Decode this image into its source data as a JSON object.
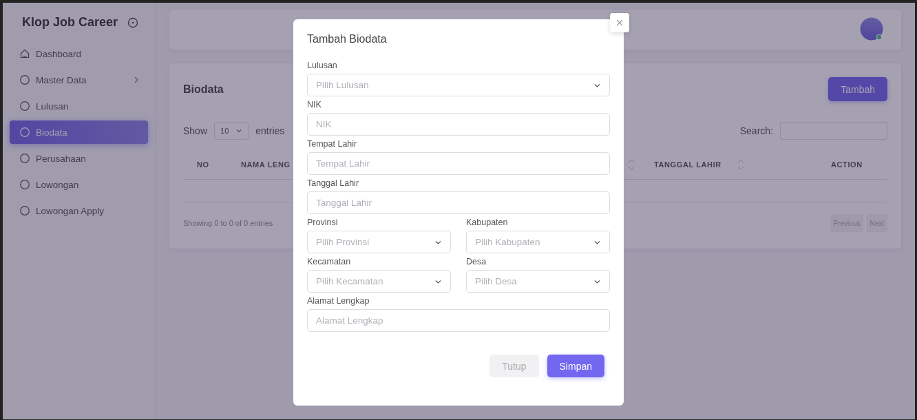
{
  "sidebar": {
    "brand": "Klop Job Career",
    "items": [
      {
        "label": "Dashboard",
        "has_submenu": false,
        "selected": false
      },
      {
        "label": "Master Data",
        "has_submenu": true,
        "selected": false
      },
      {
        "label": "Lulusan",
        "has_submenu": false,
        "selected": false
      },
      {
        "label": "Biodata",
        "has_submenu": false,
        "selected": true
      },
      {
        "label": "Perusahaan",
        "has_submenu": false,
        "selected": false
      },
      {
        "label": "Lowongan",
        "has_submenu": false,
        "selected": false
      },
      {
        "label": "Lowongan Apply",
        "has_submenu": false,
        "selected": false
      }
    ]
  },
  "card": {
    "title": "Biodata",
    "add_button": "Tambah",
    "show_label": "Show",
    "page_size": "10",
    "entries_label": "entries",
    "search_label": "Search:",
    "columns": [
      {
        "label": "NO",
        "sortable": false
      },
      {
        "label": "NAMA LENG",
        "sortable": true
      },
      {
        "label": "TANGGAL LAHIR",
        "sortable": true
      },
      {
        "label": "ACTION",
        "sortable": false
      }
    ],
    "info": "Showing 0 to 0 of 0 entries",
    "pager": [
      "Previous",
      "Next"
    ]
  },
  "modal": {
    "title": "Tambah Biodata",
    "rows": [
      [
        {
          "label": "Lulusan",
          "kind": "select",
          "placeholder": "Pilih Lulusan"
        }
      ],
      [
        {
          "label": "NIK",
          "kind": "input",
          "placeholder": "NIK"
        }
      ],
      [
        {
          "label": "Tempat Lahir",
          "kind": "input",
          "placeholder": "Tempat Lahir"
        }
      ],
      [
        {
          "label": "Tanggal Lahir",
          "kind": "input",
          "placeholder": "Tanggal Lahir"
        }
      ],
      [
        {
          "label": "Provinsi",
          "kind": "select",
          "placeholder": "Pilih Provinsi"
        },
        {
          "label": "Kabupaten",
          "kind": "select",
          "placeholder": "Pilih Kabupaten"
        }
      ],
      [
        {
          "label": "Kecamatan",
          "kind": "select",
          "placeholder": "Pilih Kecamatan"
        },
        {
          "label": "Desa",
          "kind": "select",
          "placeholder": "Pilih Desa"
        }
      ],
      [
        {
          "label": "Alamat Lengkap",
          "kind": "input",
          "placeholder": "Alamat Lengkap"
        }
      ]
    ],
    "buttons": [
      {
        "label": "Tutup",
        "kind": "secondary"
      },
      {
        "label": "Simpan",
        "kind": "primary"
      }
    ]
  }
}
